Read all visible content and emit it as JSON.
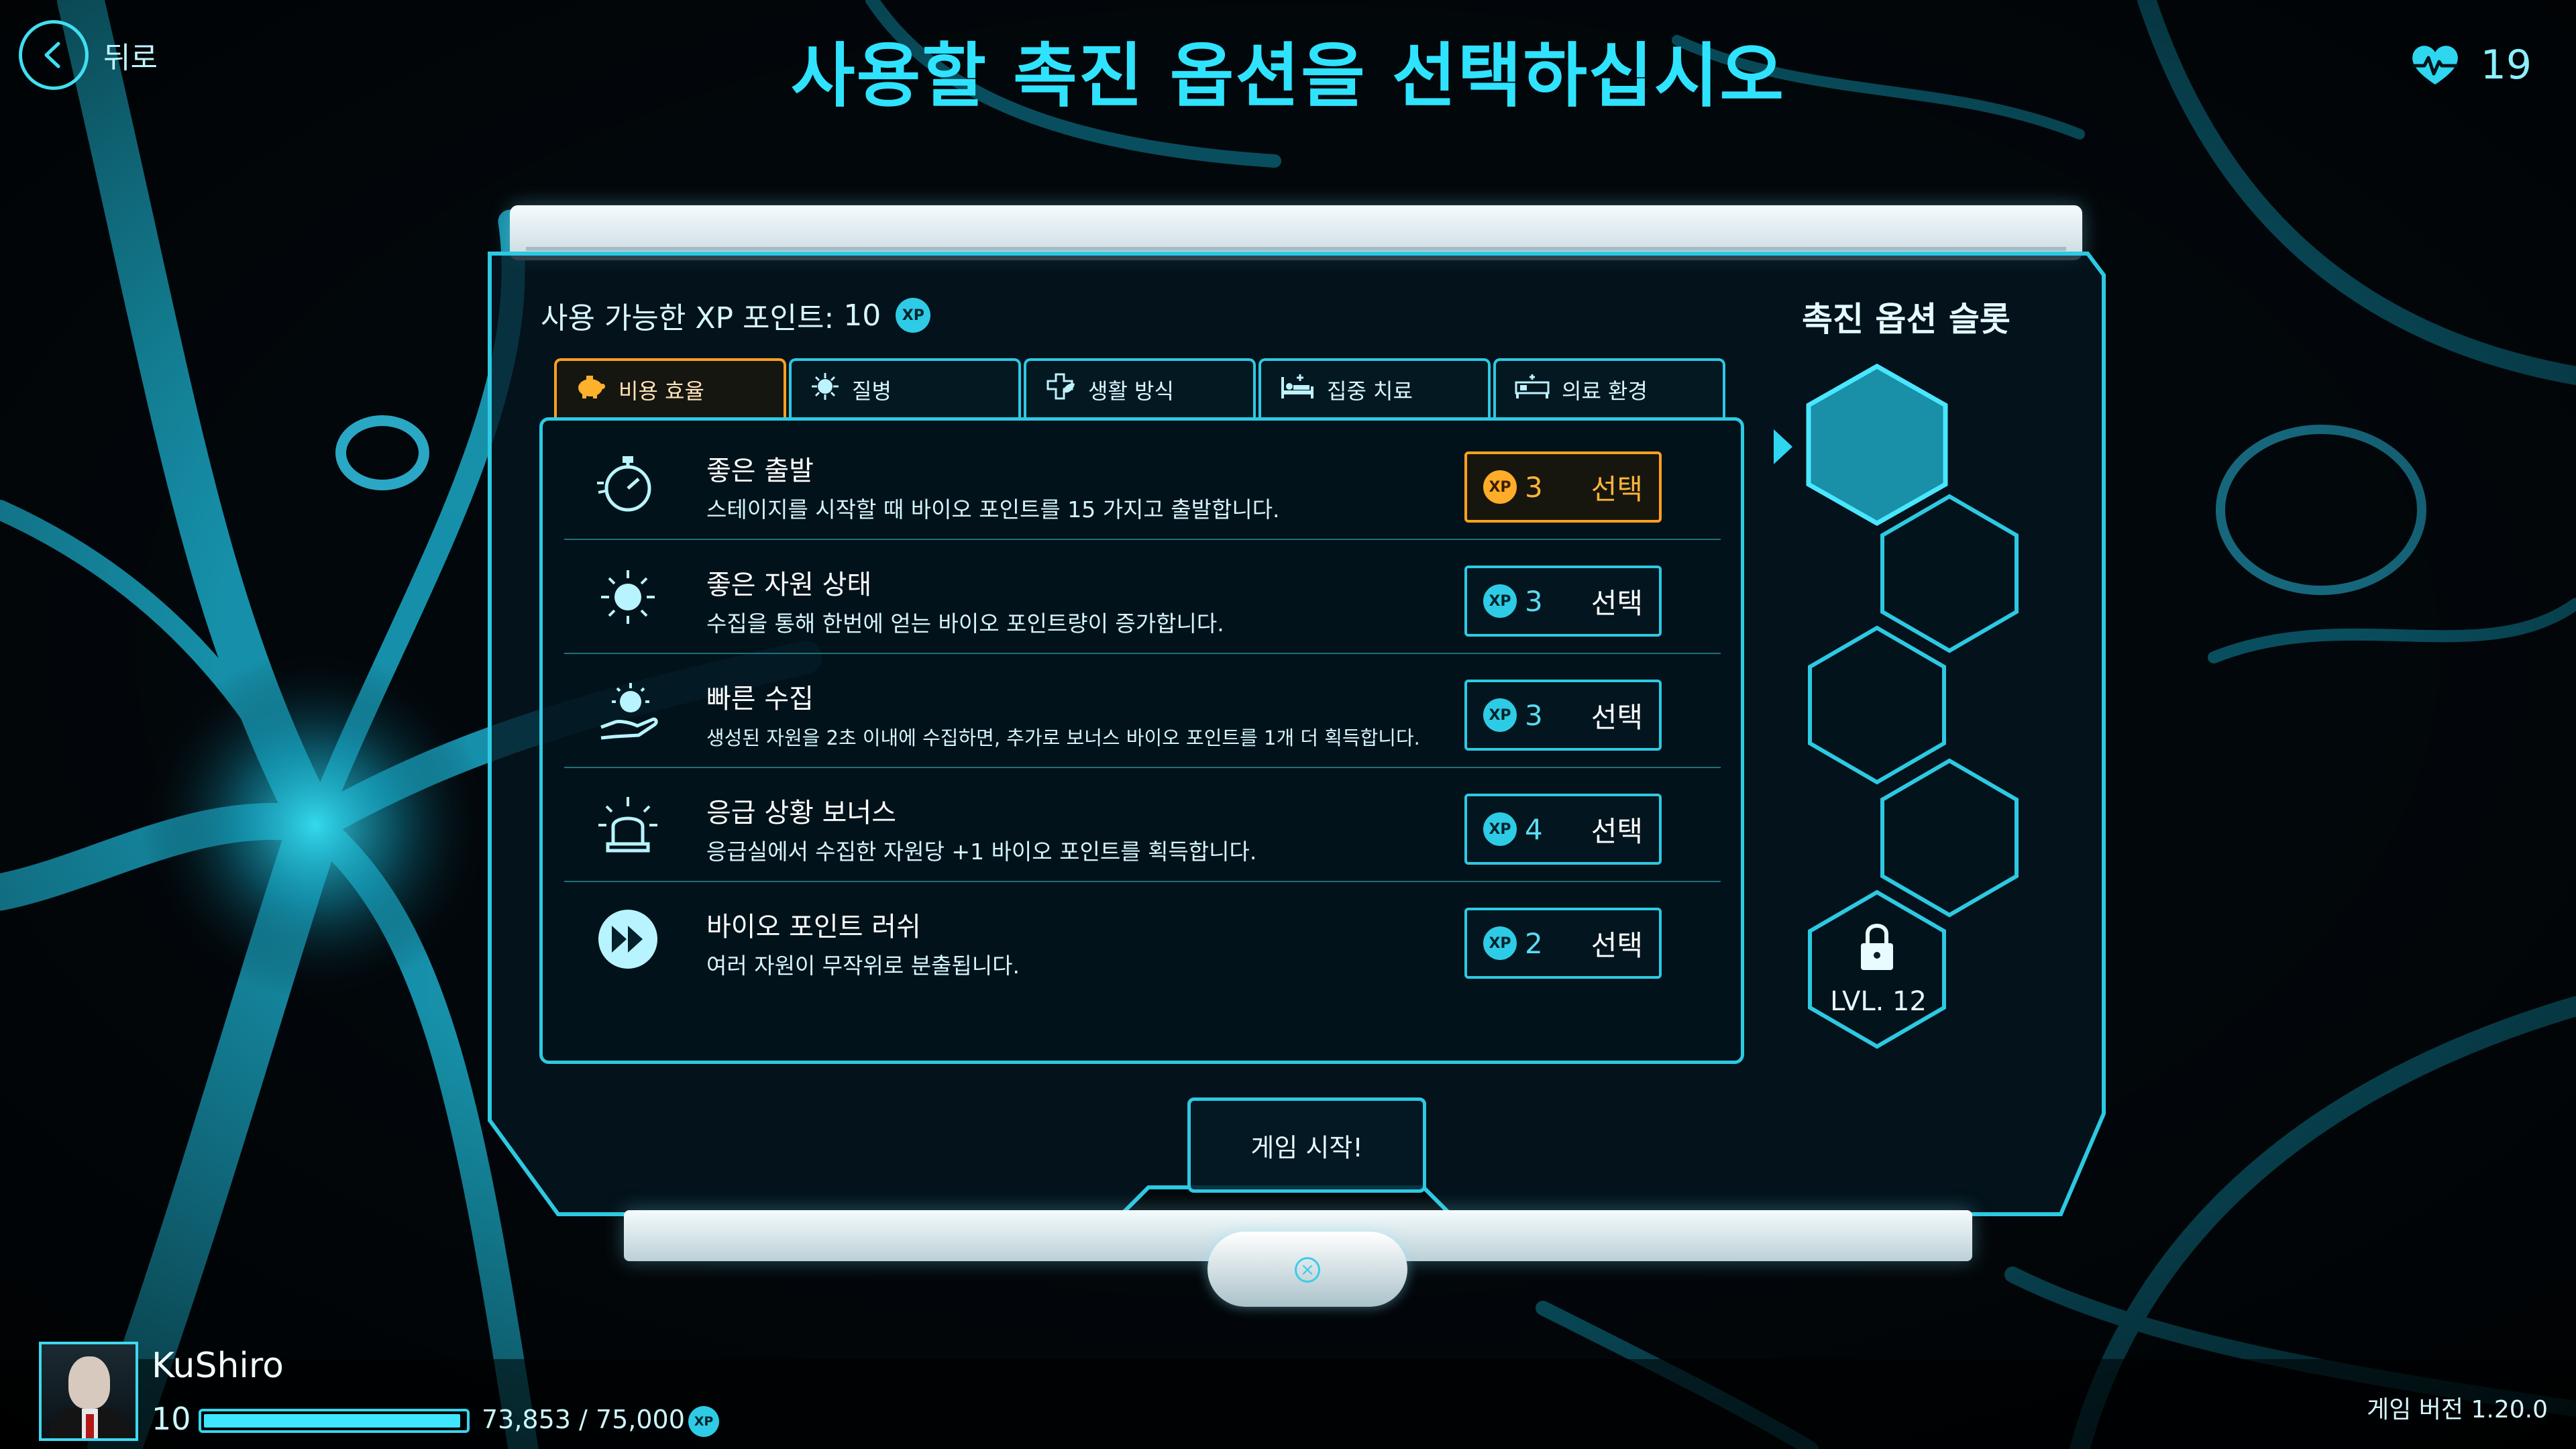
{
  "header": {
    "back_label": "뒤로",
    "title": "사용할 촉진 옵션을 선택하십시오",
    "health_value": "19"
  },
  "panel": {
    "xp_available_label": "사용 가능한 XP 포인트:",
    "xp_available_value": "10",
    "xp_badge": "XP",
    "tabs": [
      {
        "label": "비용 효율",
        "icon": "piggy-bank-icon",
        "active": true
      },
      {
        "label": "질병",
        "icon": "virus-icon",
        "active": false
      },
      {
        "label": "생활 방식",
        "icon": "health-leaf-icon",
        "active": false
      },
      {
        "label": "집중 치료",
        "icon": "hospital-bed-icon",
        "active": false
      },
      {
        "label": "의료 환경",
        "icon": "ward-bed-icon",
        "active": false
      }
    ],
    "options": [
      {
        "title": "좋은 출발",
        "description": "스테이지를 시작할 때 바이오 포인트를 15 가지고 출발합니다.",
        "cost": "3",
        "select_label": "선택",
        "icon": "stopwatch-icon"
      },
      {
        "title": "좋은 자원 상태",
        "description": "수집을 통해 한번에 얻는 바이오 포인트량이 증가합니다.",
        "cost": "3",
        "select_label": "선택",
        "icon": "germ-burst-icon"
      },
      {
        "title": "빠른 수집",
        "description": "생성된 자원을 2초 이내에 수집하면, 추가로 보너스 바이오 포인트를 1개 더 획득합니다.",
        "cost": "3",
        "select_label": "선택",
        "icon": "germ-hand-icon"
      },
      {
        "title": "응급 상황 보너스",
        "description": "응급실에서 수집한 자원당 +1 바이오 포인트를 획득합니다.",
        "cost": "4",
        "select_label": "선택",
        "icon": "siren-icon"
      },
      {
        "title": "바이오 포인트 러쉬",
        "description": "여러 자원이 무작위로 분출됩니다.",
        "cost": "2",
        "select_label": "선택",
        "icon": "fast-forward-icon"
      }
    ],
    "start_label": "게임 시작!"
  },
  "slots": {
    "title": "촉진 옵션 슬롯",
    "lock_label": "LVL. 12",
    "count": 5,
    "filled_first": true
  },
  "footer": {
    "player_name": "KuShiro",
    "player_level": "10",
    "xp_progress_text": "73,853 / 75,000",
    "xp_progress_fraction": 0.9847,
    "version_text": "게임 버전 1.20.0"
  },
  "colors": {
    "accent": "#2dc9e2",
    "highlight": "#ffa11e",
    "background": "#02070b"
  }
}
